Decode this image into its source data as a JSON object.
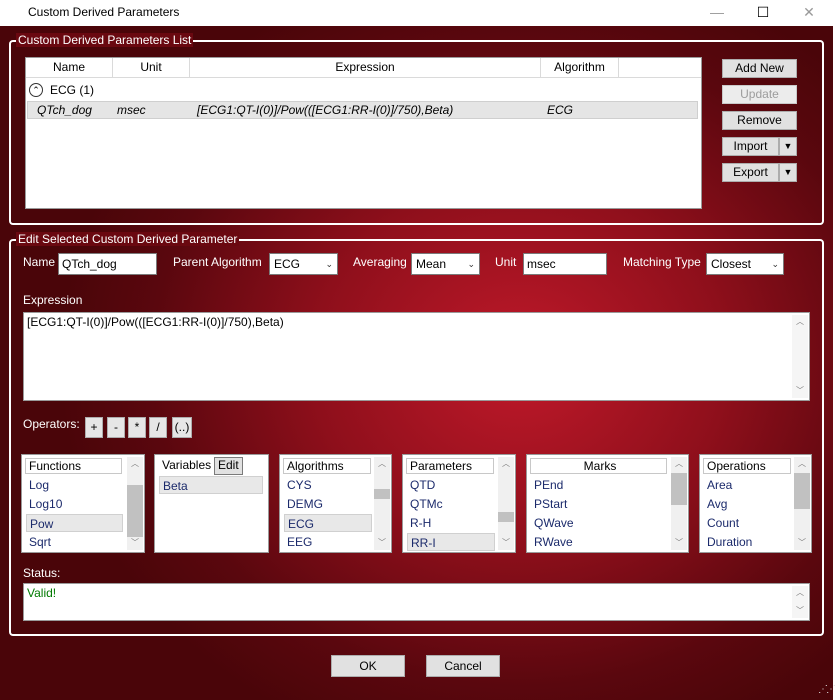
{
  "window": {
    "title": "Custom Derived Parameters",
    "controls": {
      "minimize": "—",
      "maximize": "☐",
      "close": "✕"
    }
  },
  "list_group": {
    "title": "Custom Derived Parameters List",
    "columns": [
      "Name",
      "Unit",
      "Expression",
      "Algorithm"
    ],
    "group_label": "ECG (1)",
    "rows": [
      {
        "name": "QTch_dog",
        "unit": "msec",
        "expression": "[ECG1:QT-I(0)]/Pow(([ECG1:RR-I(0)]/750),Beta)",
        "algorithm": "ECG"
      }
    ],
    "buttons": {
      "add_new": "Add New",
      "update": "Update",
      "remove": "Remove",
      "import": "Import",
      "export": "Export"
    }
  },
  "edit_group": {
    "title": "Edit Selected Custom Derived Parameter",
    "name_label": "Name",
    "name_value": "QTch_dog",
    "parent_algorithm_label": "Parent Algorithm",
    "parent_algorithm_value": "ECG",
    "averaging_label": "Averaging",
    "averaging_value": "Mean",
    "unit_label": "Unit",
    "unit_value": "msec",
    "matching_type_label": "Matching Type",
    "matching_type_value": "Closest",
    "expression_label": "Expression",
    "expression_value": "[ECG1:QT-I(0)]/Pow(([ECG1:RR-I(0)]/750),Beta)",
    "operators_label": "Operators:",
    "operators": [
      "+",
      "-",
      "*",
      "/",
      "(..)"
    ],
    "functions": {
      "header": "Functions",
      "items": [
        "Log",
        "Log10",
        "Pow",
        "Sqrt"
      ],
      "selected": "Pow"
    },
    "variables": {
      "header": "Variables",
      "edit_label": "Edit",
      "items": [
        "Beta"
      ]
    },
    "algorithms": {
      "header": "Algorithms",
      "items": [
        "CYS",
        "DEMG",
        "ECG",
        "EEG"
      ],
      "selected": "ECG"
    },
    "parameters": {
      "header": "Parameters",
      "items": [
        "QTD",
        "QTMc",
        "R-H",
        "RR-I"
      ],
      "selected": "RR-I"
    },
    "marks": {
      "header": "Marks",
      "items": [
        "PEnd",
        "PStart",
        "QWave",
        "RWave"
      ]
    },
    "operations": {
      "header": "Operations",
      "items": [
        "Area",
        "Avg",
        "Count",
        "Duration"
      ]
    },
    "status_label": "Status:",
    "status_value": "Valid!",
    "status_color": "#007a00"
  },
  "footer": {
    "ok": "OK",
    "cancel": "Cancel"
  },
  "colors": {
    "accent_dark": "#5a070e",
    "accent_bright": "#c0192a",
    "item_text": "#1b2a6b"
  }
}
